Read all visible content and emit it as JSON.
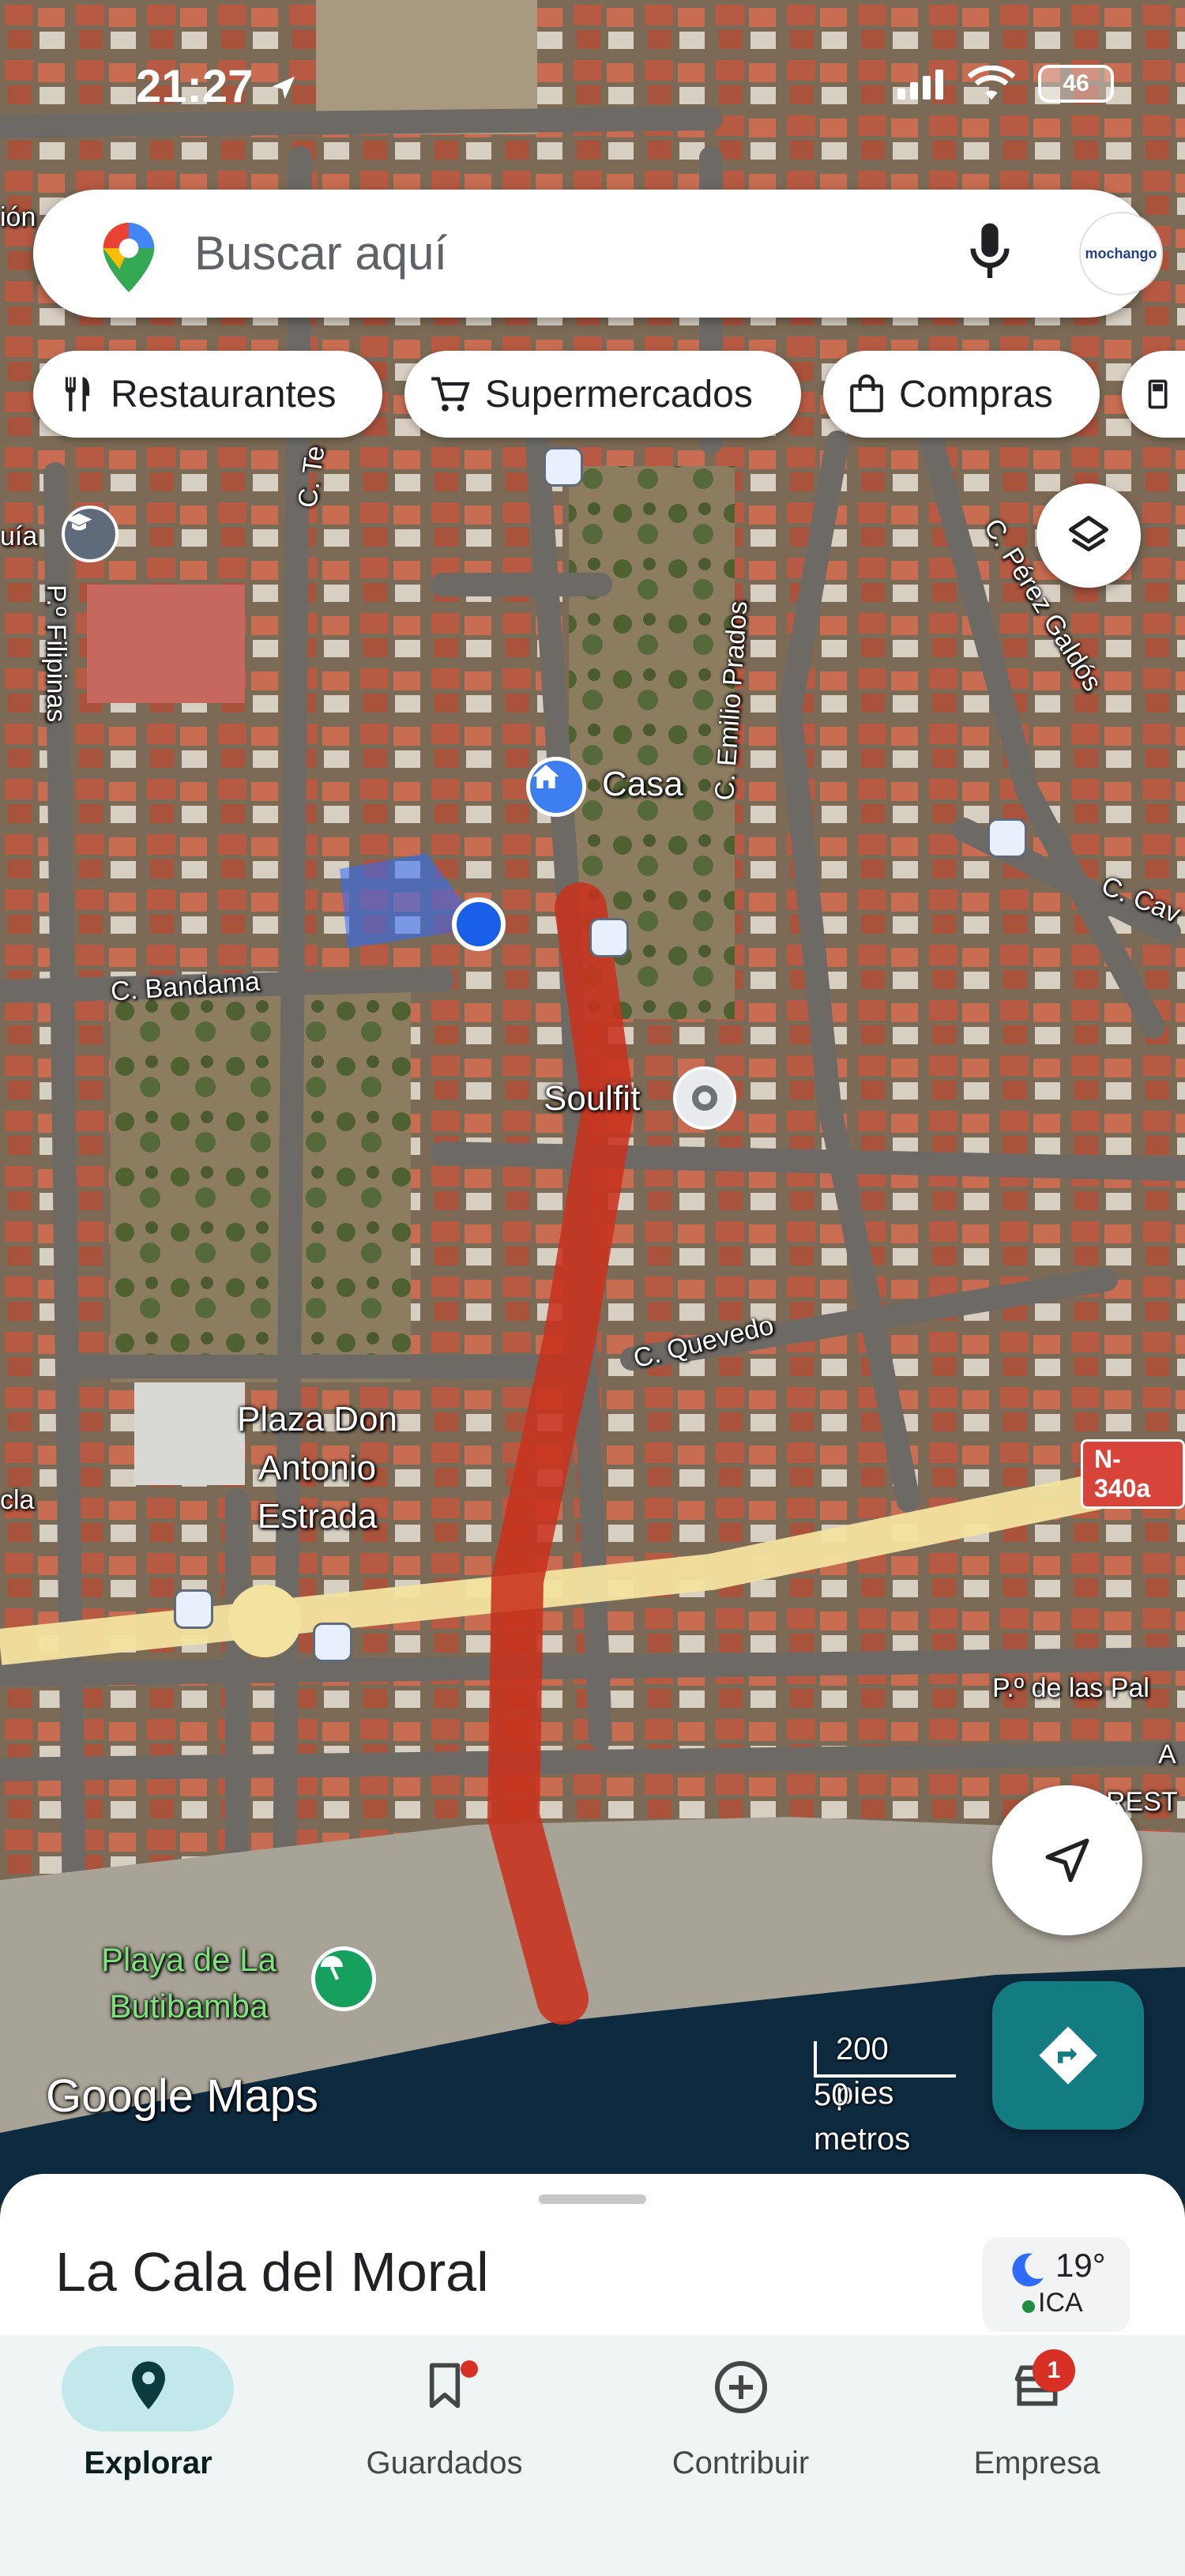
{
  "status_bar": {
    "time": "21:27",
    "battery": "46"
  },
  "search": {
    "placeholder": "Buscar aquí",
    "avatar_text": "mochango"
  },
  "chips": [
    {
      "label": "Restaurantes",
      "icon": "fork-knife-icon"
    },
    {
      "label": "Supermercados",
      "icon": "cart-icon"
    },
    {
      "label": "Compras",
      "icon": "shopping-bag-icon"
    }
  ],
  "map": {
    "places": {
      "casa": "Casa",
      "soulfit": "Soulfit",
      "plaza": "Plaza Don\nAntonio\nEstrada",
      "beach": "Playa de La\nButibamba"
    },
    "streets": {
      "bandama": "C. Bandama",
      "quevedo": "C. Quevedo",
      "emilio_prados": "C. Emilio Prados",
      "perez_galdos": "C. Pérez Galdós",
      "filipinas": "P.º Filipinas",
      "te": "C. Te",
      "cav": "C. Cav",
      "palmeras": "P.º de las Pal",
      "edge_left_top": "ión",
      "edge_left_guia": "uía",
      "edge_left_cla": "cla",
      "edge_right_a": "A",
      "edge_right_rest": "REST"
    },
    "road_tag": "N-340a",
    "colors": {
      "route": "#c8321e",
      "highway": "#f3e3a0",
      "location": "#1a5fe8",
      "sea": "#0d2a3f"
    }
  },
  "scale": {
    "imperial": "200 pies",
    "metric": "50 metros"
  },
  "logo": "Google Maps",
  "sheet": {
    "title": "La Cala del Moral"
  },
  "weather": {
    "temp": "19°",
    "aqi": "ICA"
  },
  "nav": {
    "items": [
      {
        "label": "Explorar"
      },
      {
        "label": "Guardados"
      },
      {
        "label": "Contribuir"
      },
      {
        "label": "Empresa",
        "badge": "1"
      }
    ]
  }
}
